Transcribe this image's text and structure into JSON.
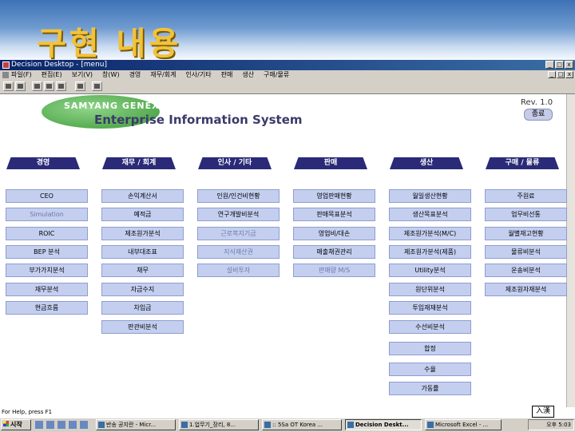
{
  "slide": {
    "title": "구현 내용"
  },
  "window": {
    "title": "Decision Desktop - [menu]",
    "controls": [
      "_",
      "□",
      "x"
    ]
  },
  "menubar": {
    "items": [
      "파일(F)",
      "편집(E)",
      "보기(V)",
      "창(W)",
      "경영",
      "재무/회계",
      "인사/기타",
      "판매",
      "생산",
      "구매/물류"
    ],
    "mdi_controls": [
      "_",
      "□",
      "x"
    ]
  },
  "toolbar": {
    "buttons": [
      "print-icon",
      "preview-icon",
      "cut-icon",
      "copy-icon",
      "paste-icon",
      "window-icon",
      "save-icon"
    ]
  },
  "header": {
    "company": "SAMYANG GENEX",
    "system": "Enterprise Information System",
    "rev": "Rev. 1.0",
    "exit_label": "종료",
    "logo_color": "#4caf45"
  },
  "categories": [
    {
      "label": "경영",
      "items": [
        {
          "label": "CEO",
          "faded": false
        },
        {
          "label": "Simulation",
          "faded": true
        },
        {
          "label": "ROIC",
          "faded": false
        },
        {
          "label": "BEP 분석",
          "faded": false
        },
        {
          "label": "부가가치분석",
          "faded": false
        },
        {
          "label": "재무분석",
          "faded": false
        },
        {
          "label": "현금흐름",
          "faded": false
        }
      ]
    },
    {
      "label": "재무 / 회계",
      "items": [
        {
          "label": "손익계산서",
          "faded": false
        },
        {
          "label": "예적금",
          "faded": false
        },
        {
          "label": "제조원가분석",
          "faded": false
        },
        {
          "label": "내부대조표",
          "faded": false
        },
        {
          "label": "채무",
          "faded": false
        },
        {
          "label": "자금수지",
          "faded": false
        },
        {
          "label": "차입금",
          "faded": false
        },
        {
          "label": "판관비분석",
          "faded": false
        }
      ]
    },
    {
      "label": "인사 / 기타",
      "items": [
        {
          "label": "인원/인건비현황",
          "faded": false
        },
        {
          "label": "연구개발비분석",
          "faded": false
        },
        {
          "label": "근로복지기금",
          "faded": false
        },
        {
          "label": "지식재산권",
          "faded": false
        },
        {
          "label": "설비투자",
          "faded": false
        }
      ]
    },
    {
      "label": "판매",
      "items": [
        {
          "label": "영업판매현황",
          "faded": false
        },
        {
          "label": "판매목표분석",
          "faded": false
        },
        {
          "label": "영업비/대손",
          "faded": false
        },
        {
          "label": "매출채권관리",
          "faded": false
        },
        {
          "label": "판매량 M/S",
          "faded": false
        }
      ]
    },
    {
      "label": "생산",
      "items": [
        {
          "label": "월일생산현황",
          "faded": false
        },
        {
          "label": "생산목표분석",
          "faded": false
        },
        {
          "label": "제조원가분석(M/C)",
          "faded": false
        },
        {
          "label": "제조원가분석(제품)",
          "faded": false
        },
        {
          "label": "Utility분석",
          "faded": false
        },
        {
          "label": "원단위분석",
          "faded": false
        },
        {
          "label": "투입재재분석",
          "faded": false
        },
        {
          "label": "수선비분석",
          "faded": false
        },
        {
          "label": "합정",
          "faded": false
        },
        {
          "label": "수율",
          "faded": false
        },
        {
          "label": "가동률",
          "faded": false
        }
      ]
    },
    {
      "label": "구매 / 물류",
      "items": [
        {
          "label": "주원료",
          "faded": false
        },
        {
          "label": "업무비선통",
          "faded": false
        },
        {
          "label": "월별재고현황",
          "faded": false
        },
        {
          "label": "물류비분석",
          "faded": false
        },
        {
          "label": "운송비분석",
          "faded": false
        },
        {
          "label": "제조원자재분석",
          "faded": false
        }
      ]
    }
  ],
  "statusbar": {
    "text": "For Help, press F1"
  },
  "ime": {
    "label": "入漢"
  },
  "taskbar": {
    "start_label": "시작",
    "tasks": [
      {
        "label": "반송 공지란 - Micr...",
        "active": false
      },
      {
        "label": "1.업무기_장리, 8...",
        "active": false
      },
      {
        "label": ":: 5Sa OT Korea ...",
        "active": false
      },
      {
        "label": "Decision Deskt...",
        "active": true
      },
      {
        "label": "Microsoft Excel - ...",
        "active": false
      }
    ],
    "clock": "오후 5:03"
  }
}
